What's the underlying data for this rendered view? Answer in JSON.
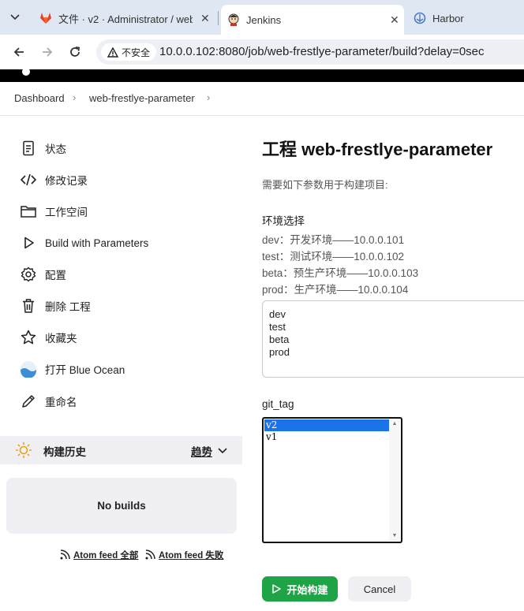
{
  "browser": {
    "tabs": [
      {
        "title": "文件 · v2 · Administrator / web",
        "icon": "gitlab-icon",
        "active": false
      },
      {
        "title": "Jenkins",
        "icon": "jenkins-icon",
        "active": true
      },
      {
        "title": "Harbor",
        "icon": "harbor-icon",
        "active": false
      }
    ],
    "security_label": "不安全",
    "url": "10.0.0.102:8080/job/web-frestlye-parameter/build?delay=0sec"
  },
  "breadcrumb": [
    "Dashboard",
    "web-frestlye-parameter"
  ],
  "sidebar": {
    "items": [
      {
        "label": "状态",
        "icon": "document-icon"
      },
      {
        "label": "修改记录",
        "icon": "code-icon"
      },
      {
        "label": "工作空间",
        "icon": "folder-icon"
      },
      {
        "label": "Build with Parameters",
        "icon": "play-icon"
      },
      {
        "label": "配置",
        "icon": "gear-icon"
      },
      {
        "label": "删除 工程",
        "icon": "trash-icon"
      },
      {
        "label": "收藏夹",
        "icon": "star-icon"
      },
      {
        "label": "打开 Blue Ocean",
        "icon": "blue-ocean-icon"
      },
      {
        "label": "重命名",
        "icon": "pencil-icon"
      }
    ],
    "build_history": {
      "title": "构建历史",
      "trend_label": "趋势",
      "empty_text": "No builds",
      "feed_all": "Atom feed 全部",
      "feed_failed": "Atom feed 失败"
    }
  },
  "main": {
    "title": "工程 web-frestlye-parameter",
    "description": "需要如下参数用于构建项目:",
    "env_param": {
      "name": "环境选择",
      "description_lines": [
        "dev：开发环境——10.0.0.101",
        "test：测试环境——10.0.0.102",
        "beta：预生产环境——10.0.0.103",
        "prod：生产环境——10.0.0.104"
      ],
      "value_lines": [
        "dev",
        "test",
        "beta",
        "prod"
      ]
    },
    "git_param": {
      "name": "git_tag",
      "options": [
        "v2",
        "v1"
      ],
      "selected": "v2"
    },
    "build_button": "开始构建",
    "cancel_button": "Cancel"
  },
  "colors": {
    "build_green": "#1ea446",
    "selection_blue": "#1a73e8",
    "tab_strip": "#dfe7f2"
  }
}
